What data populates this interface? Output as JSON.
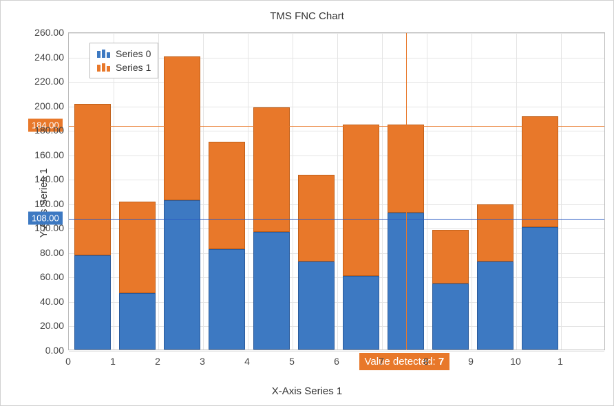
{
  "chart_data": {
    "type": "bar",
    "stacked": true,
    "title": "TMS FNC Chart",
    "xlabel": "X-Axis Series 1",
    "ylabel": "Y-Axis Series 1",
    "ylim": [
      0,
      260
    ],
    "categories": [
      0,
      1,
      2,
      3,
      4,
      5,
      6,
      7,
      8,
      9,
      10
    ],
    "series": [
      {
        "name": "Series 0",
        "color": "#3d79c2",
        "values": [
          77,
          46,
          122,
          82,
          96,
          72,
          60,
          112,
          54,
          72,
          100
        ]
      },
      {
        "name": "Series 1",
        "color": "#e8782a",
        "values": [
          124,
          75,
          118,
          88,
          102,
          71,
          124,
          72,
          44,
          47,
          91
        ]
      }
    ],
    "totals": [
      201,
      121,
      240,
      170,
      198,
      143,
      184,
      184,
      98,
      119,
      191
    ],
    "reference_lines": [
      {
        "value": 108.0,
        "label": "108.00",
        "color": "#3d79c2"
      },
      {
        "value": 184.0,
        "label": "184.00",
        "color": "#e8782a"
      }
    ],
    "crosshair_x": 7,
    "value_detected": {
      "prefix": "Value detected: ",
      "value": "7"
    }
  },
  "y_ticks": [
    "0.00",
    "20.00",
    "40.00",
    "60.00",
    "80.00",
    "100.00",
    "120.00",
    "140.00",
    "160.00",
    "180.00",
    "200.00",
    "220.00",
    "240.00",
    "260.00"
  ],
  "x_ticks": [
    "0",
    "1",
    "2",
    "3",
    "4",
    "5",
    "6",
    "7",
    "8",
    "9",
    "10",
    "1"
  ]
}
